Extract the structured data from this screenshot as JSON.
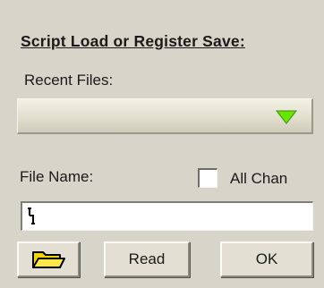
{
  "panel": {
    "title": "Script Load or Register Save:",
    "recent_files": {
      "label": "Recent Files:",
      "selected_value": "",
      "arrow_icon": "triangle-down-icon",
      "arrow_color": "#66e600"
    },
    "file_name": {
      "label": "File Name:",
      "value": "",
      "cursor_icon": "text-cursor-icon"
    },
    "all_chan": {
      "label": "All Chan",
      "checked": false
    },
    "buttons": {
      "open_icon": "folder-open-icon",
      "read_label": "Read",
      "ok_label": "OK"
    }
  }
}
